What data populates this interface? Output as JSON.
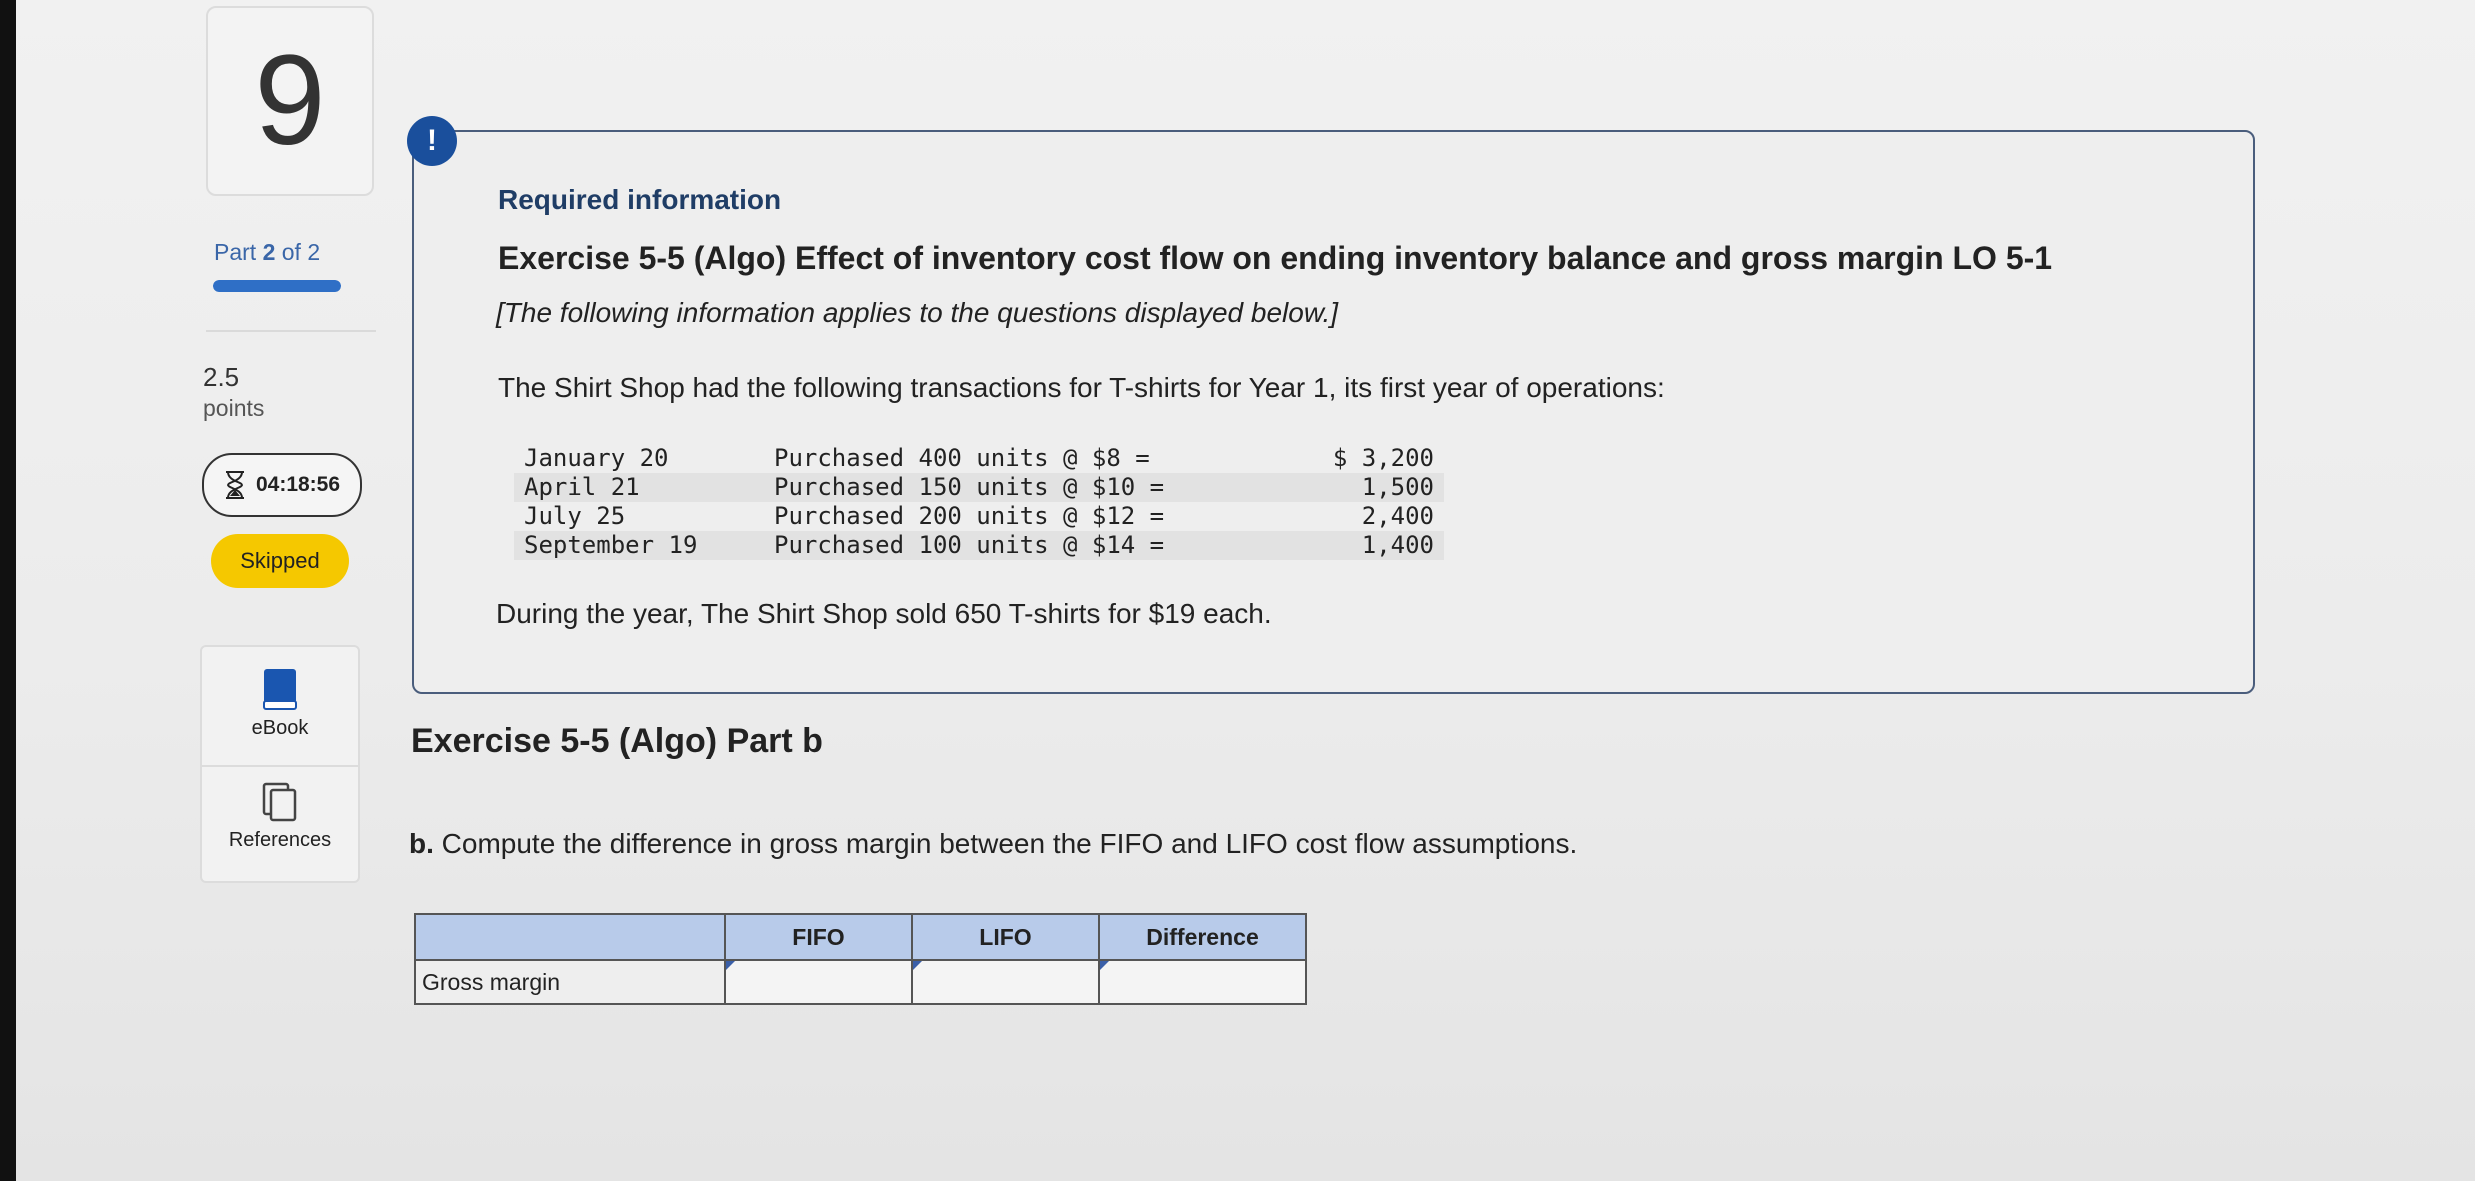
{
  "question_number": "9",
  "part": {
    "prefix": "Part",
    "current": "2",
    "separator": "of 2",
    "progress_fraction": 1.0
  },
  "points": {
    "value": "2.5",
    "label": "points"
  },
  "timer": {
    "icon": "hourglass-icon",
    "value": "04:18:56"
  },
  "status_badge": "Skipped",
  "tools": [
    {
      "label": "eBook",
      "icon": "book-icon"
    },
    {
      "label": "References",
      "icon": "references-icon"
    }
  ],
  "info": {
    "alert_icon": "!",
    "heading": "Required information",
    "exercise_title": "Exercise 5-5 (Algo) Effect of inventory cost flow on ending inventory balance and gross margin LO 5-1",
    "note": "[The following information applies to the questions displayed below.]",
    "intro": "The Shirt Shop had the following transactions for T-shirts for Year 1, its first year of operations:",
    "transactions": [
      {
        "date": "January 20",
        "desc": "Purchased 400 units @ $8 =",
        "amount": "$ 3,200"
      },
      {
        "date": "April 21",
        "desc": "Purchased 150 units @ $10 =",
        "amount": "1,500"
      },
      {
        "date": "July 25",
        "desc": "Purchased 200 units @ $12 =",
        "amount": "2,400"
      },
      {
        "date": "September 19",
        "desc": "Purchased 100 units @ $14 =",
        "amount": "1,400"
      }
    ],
    "sales_text": "During the year, The Shirt Shop sold 650 T-shirts for $19 each."
  },
  "part_b": {
    "title": "Exercise 5-5 (Algo) Part b",
    "question_letter": "b.",
    "question_text": "Compute the difference in gross margin between the FIFO and LIFO cost flow assumptions.",
    "table": {
      "headers": [
        "",
        "FIFO",
        "LIFO",
        "Difference"
      ],
      "row_label": "Gross margin",
      "values": [
        "",
        "",
        ""
      ]
    }
  },
  "colors": {
    "accent": "#1a4f9c",
    "badge": "#f5c800",
    "table_header": "#b8cbea"
  }
}
